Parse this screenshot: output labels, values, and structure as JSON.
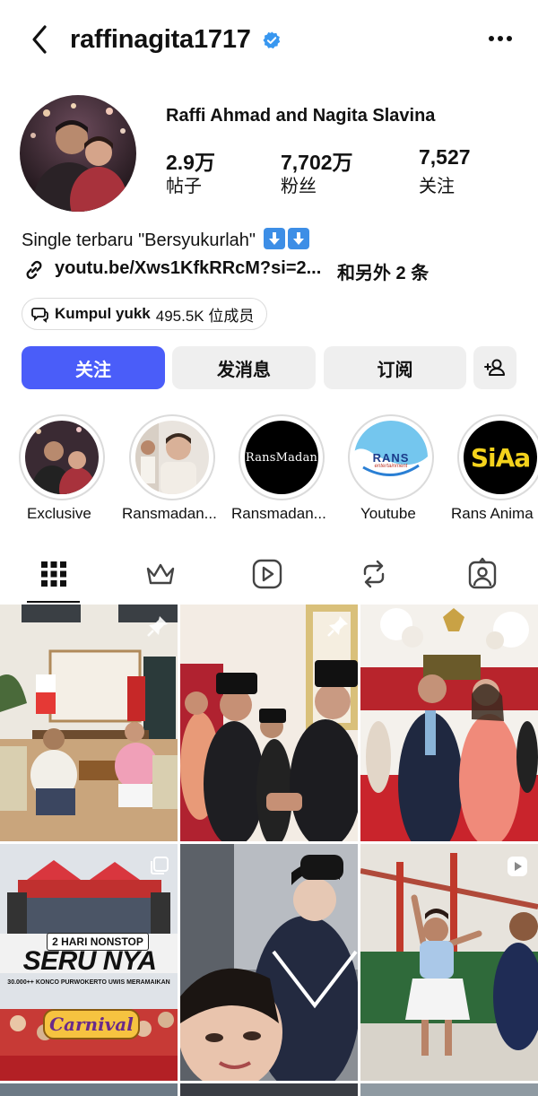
{
  "header": {
    "username": "raffinagita1717"
  },
  "profile": {
    "full_name": "Raffi Ahmad and Nagita Slavina",
    "stats": [
      {
        "value": "2.9万",
        "label": "帖子"
      },
      {
        "value": "7,702万",
        "label": "粉丝"
      },
      {
        "value": "7,527",
        "label": "关注"
      }
    ],
    "bio": "Single terbaru \"Bersyukurlah\"",
    "link": "youtu.be/Xws1KfkRRcM?si=2...",
    "link_more": "和另外 2 条",
    "channel": {
      "name": "Kumpul yukk",
      "members": "495.5K 位成员"
    }
  },
  "buttons": {
    "follow": "关注",
    "message": "发消息",
    "subscribe": "订阅"
  },
  "highlights": [
    {
      "label": "Exclusive"
    },
    {
      "label": "Ransmadan..."
    },
    {
      "label": "Ransmadan...",
      "cover_text": "RansMadan"
    },
    {
      "label": "Youtube",
      "cover_text": "RANS",
      "cover_subtext": "entertainment"
    },
    {
      "label": "Rans Anima",
      "cover_text": "SiAa"
    }
  ],
  "posts": {
    "row2_col1": {
      "banner": "2 HARI NONSTOP",
      "headline": "SERU NYA",
      "subline": "30.000++ KONCO PURWOKERTO UWIS MERAMAIKAN",
      "badge": "Carnival"
    }
  },
  "colors": {
    "primary": "#4a5df9",
    "verified": "#3897f0",
    "secondary_bg": "#efefef"
  }
}
